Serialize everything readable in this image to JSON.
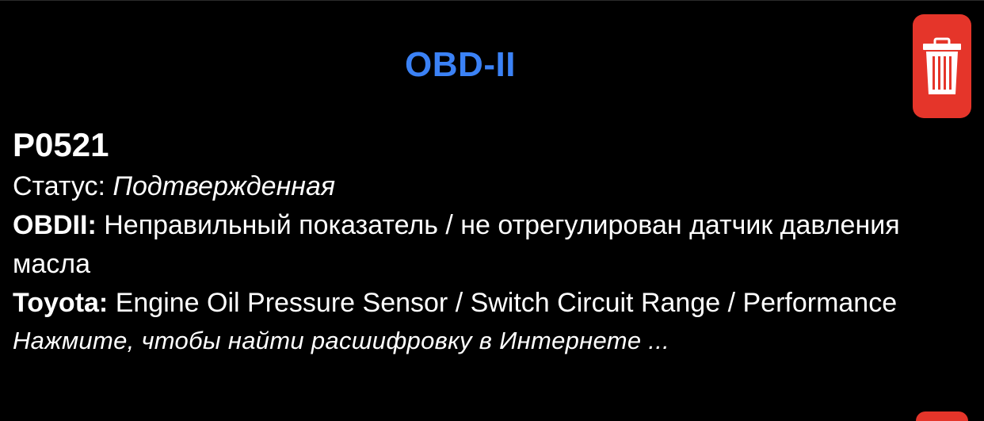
{
  "header": {
    "title": "OBD-II",
    "delete_icon": "trash-icon"
  },
  "colors": {
    "title": "#3b82f6",
    "delete_button": "#e5352a",
    "background": "#000000",
    "text": "#ffffff"
  },
  "dtc": {
    "code": "P0521",
    "status_label": "Статус:",
    "status_value": "Подтвержденная",
    "obdii_label": "OBDII:",
    "obdii_description": "Неправильный показатель / не отрегулирован датчик давления масла",
    "toyota_label": "Toyota:",
    "toyota_description": "Engine Oil Pressure Sensor / Switch Circuit Range / Performance",
    "search_hint": "Нажмите, чтобы найти расшифровку в Интернете ..."
  }
}
